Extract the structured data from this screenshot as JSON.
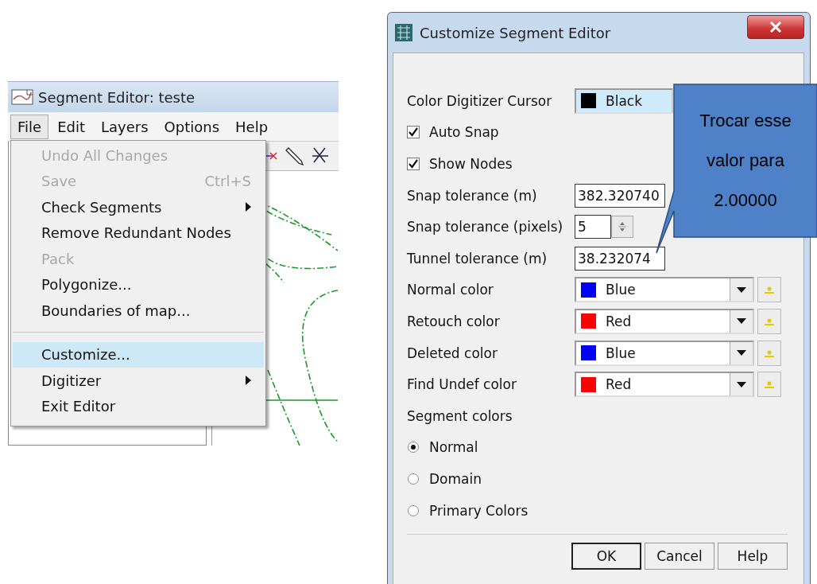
{
  "left_window": {
    "title": "Segment Editor: teste",
    "menu_bar": [
      {
        "label": "File",
        "selected": true
      },
      {
        "label": "Edit",
        "selected": false
      },
      {
        "label": "Layers",
        "selected": false
      },
      {
        "label": "Options",
        "selected": false
      },
      {
        "label": "Help",
        "selected": false
      }
    ],
    "file_menu": {
      "groups": [
        {
          "items": [
            {
              "label": "Undo All Changes",
              "disabled": true,
              "selected": false,
              "submenu": false
            },
            {
              "label": "Save",
              "shortcut": "Ctrl+S",
              "disabled": true,
              "selected": false,
              "submenu": false
            },
            {
              "label": "Check Segments",
              "disabled": false,
              "selected": false,
              "submenu": true
            },
            {
              "label": "Remove Redundant Nodes",
              "disabled": false,
              "selected": false,
              "submenu": false
            },
            {
              "label": "Pack",
              "disabled": true,
              "selected": false,
              "submenu": false
            },
            {
              "label": "Polygonize...",
              "disabled": false,
              "selected": false,
              "submenu": false
            },
            {
              "label": "Boundaries of map...",
              "disabled": false,
              "selected": false,
              "submenu": false
            }
          ]
        },
        {
          "items": [
            {
              "label": "Customize...",
              "disabled": false,
              "selected": true,
              "submenu": false
            },
            {
              "label": "Digitizer",
              "disabled": false,
              "selected": false,
              "submenu": true
            },
            {
              "label": "Exit Editor",
              "disabled": false,
              "selected": false,
              "submenu": false
            }
          ]
        }
      ]
    }
  },
  "dialog": {
    "title": "Customize Segment Editor",
    "rows": [
      {
        "kind": "color",
        "label": "Color Digitizer Cursor",
        "value": "Black",
        "color": "#000000",
        "focused": true
      },
      {
        "kind": "checkbox",
        "label": "Auto Snap",
        "checked": true
      },
      {
        "kind": "checkbox",
        "label": "Show Nodes",
        "checked": true
      },
      {
        "kind": "number",
        "label": "Snap tolerance (m)",
        "value": "382.320740"
      },
      {
        "kind": "spinner",
        "label": "Snap tolerance (pixels)",
        "value": "5"
      },
      {
        "kind": "number",
        "label": "Tunnel tolerance (m)",
        "value": "38.232074"
      },
      {
        "kind": "color",
        "label": "Normal color",
        "value": "Blue",
        "color": "#0000ff",
        "focused": false
      },
      {
        "kind": "color",
        "label": "Retouch color",
        "value": "Red",
        "color": "#ff0000",
        "focused": false
      },
      {
        "kind": "color",
        "label": "Deleted color",
        "value": "Blue",
        "color": "#0000ff",
        "focused": false
      },
      {
        "kind": "color",
        "label": "Find Undef color",
        "value": "Red",
        "color": "#ff0000",
        "focused": false
      }
    ],
    "segment_colors": {
      "label": "Segment colors",
      "options": [
        {
          "label": "Normal",
          "selected": true
        },
        {
          "label": "Domain",
          "selected": false
        },
        {
          "label": "Primary Colors",
          "selected": false
        }
      ]
    },
    "buttons": [
      {
        "label": "OK",
        "default": true
      },
      {
        "label": "Cancel",
        "default": false
      },
      {
        "label": "Help",
        "default": false
      }
    ]
  },
  "callout": {
    "text": "Trocar esse valor para 2.00000"
  }
}
